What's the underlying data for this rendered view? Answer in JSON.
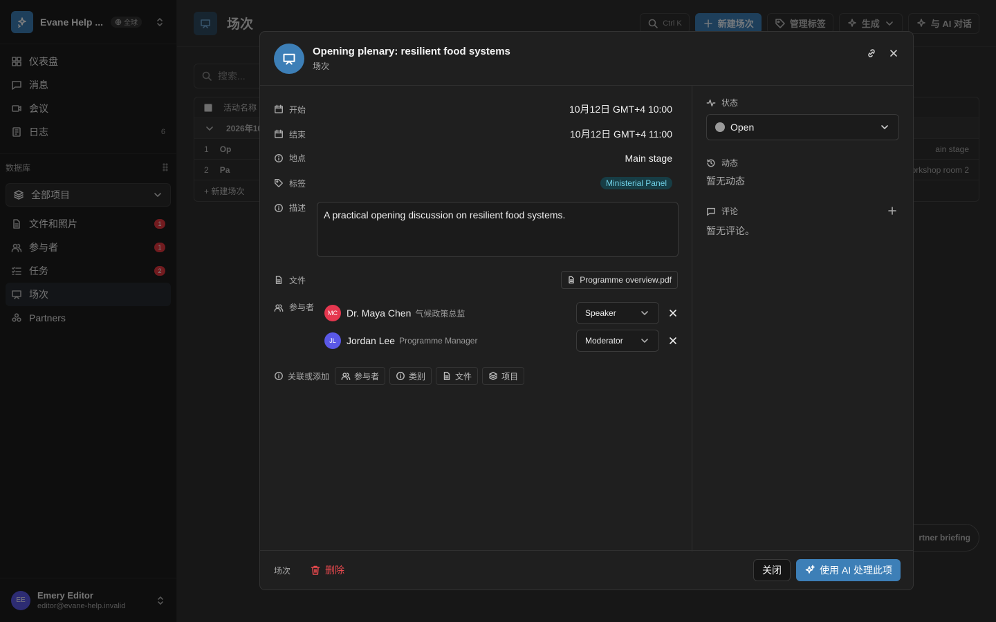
{
  "workspace": {
    "name": "Evane Help ...",
    "scope_badge": "全球"
  },
  "nav": [
    {
      "label": "仪表盘",
      "icon": "dashboard-icon"
    },
    {
      "label": "消息",
      "icon": "message-icon"
    },
    {
      "label": "会议",
      "icon": "video-icon"
    },
    {
      "label": "日志",
      "icon": "log-icon",
      "count": "6"
    }
  ],
  "database": {
    "heading": "数据库",
    "selector": "全部项目",
    "items": [
      {
        "label": "文件和照片",
        "badge": "1"
      },
      {
        "label": "参与者",
        "badge": "1"
      },
      {
        "label": "任务",
        "badge": "2"
      },
      {
        "label": "场次",
        "active": true
      },
      {
        "label": "Partners"
      }
    ]
  },
  "user": {
    "initials": "EE",
    "name": "Emery Editor",
    "email": "editor@evane-help.invalid"
  },
  "background": {
    "page_title": "场次",
    "toolbar": {
      "kbd": "Ctrl K",
      "new_session": "新建场次",
      "manage_tags": "管理标签",
      "generate": "生成",
      "ai_chat": "与 AI 对话"
    },
    "search_placeholder": "搜索...",
    "table": {
      "header": "活动名称",
      "group": "2026年10...",
      "rows": [
        {
          "num": "1",
          "name": "Op",
          "location": "ain stage"
        },
        {
          "num": "2",
          "name": "Pa",
          "location": "Vorkshop room 2"
        }
      ],
      "add_row": "+ 新建场次"
    },
    "floating_pill": "rtner briefing"
  },
  "modal": {
    "title": "Opening plenary: resilient food systems",
    "subtitle": "场次",
    "fields": {
      "start": {
        "label": "开始",
        "value": "10月12日 GMT+4 10:00"
      },
      "end": {
        "label": "结束",
        "value": "10月12日 GMT+4 11:00"
      },
      "location": {
        "label": "地点",
        "value": "Main stage"
      },
      "tags": {
        "label": "标签",
        "value": "Ministerial Panel"
      },
      "description": {
        "label": "描述",
        "value": "A practical opening discussion on resilient food systems."
      },
      "files": {
        "label": "文件",
        "value": "Programme overview.pdf"
      },
      "participants": {
        "label": "参与者"
      }
    },
    "participants": [
      {
        "initials": "MC",
        "name": "Dr. Maya Chen",
        "role": "气候政策总监",
        "session_role": "Speaker",
        "color": "#e5374f"
      },
      {
        "initials": "JL",
        "name": "Jordan Lee",
        "role": "Programme Manager",
        "session_role": "Moderator",
        "color": "#5a58e6"
      }
    ],
    "link_bar": {
      "label": "关联或添加",
      "buttons": [
        "参与者",
        "类别",
        "文件",
        "项目"
      ]
    },
    "status": {
      "label": "状态",
      "value": "Open"
    },
    "activity": {
      "label": "动态",
      "empty": "暂无动态"
    },
    "comments": {
      "label": "评论",
      "empty": "暂无评论。"
    },
    "footer": {
      "type": "场次",
      "delete": "删除",
      "close": "关闭",
      "ai": "使用 AI 处理此项"
    }
  }
}
